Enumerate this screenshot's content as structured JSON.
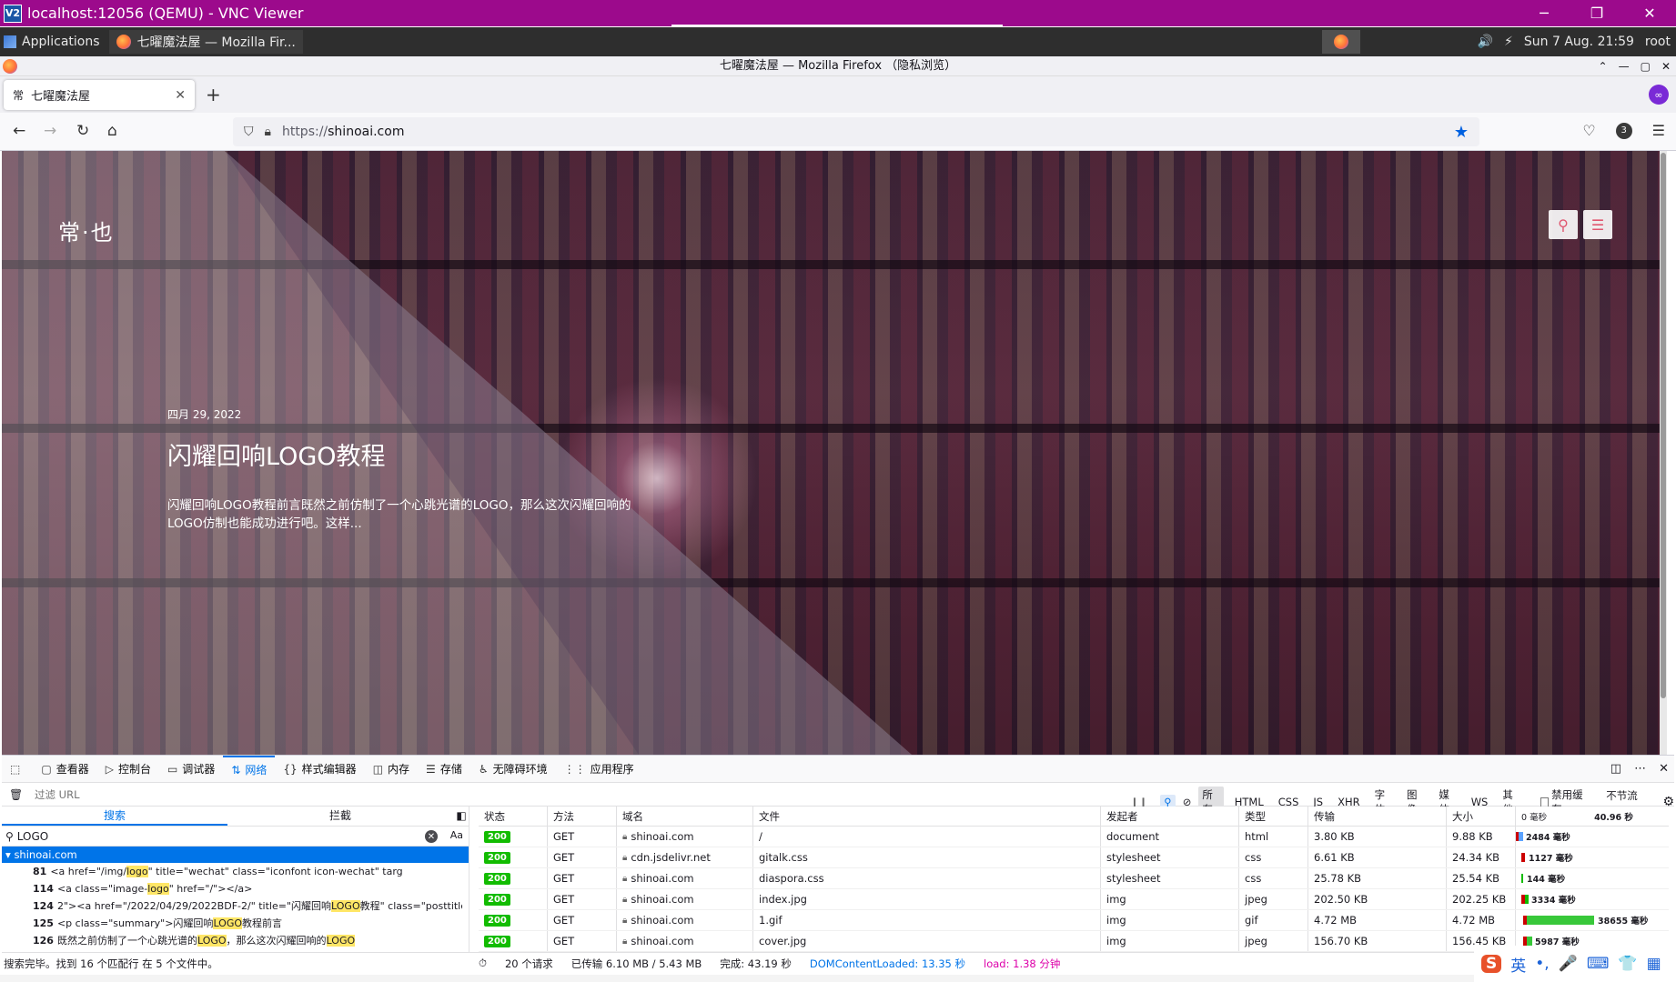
{
  "vnc": {
    "title": "localhost:12056 (QEMU) - VNC Viewer",
    "logo": "V2",
    "minimize": "─",
    "restore": "❐",
    "close": "✕"
  },
  "panel": {
    "applications": "Applications",
    "task_label": "七曜魔法屋 — Mozilla Fir...",
    "volume": "🔊",
    "net": "⚡",
    "clock": "Sun  7 Aug. 21:59",
    "user": "root"
  },
  "firefox": {
    "window_title": "七曜魔法屋 — Mozilla Firefox （隐私浏览）",
    "tab_title": "七曜魔法屋",
    "tab_favicon": "常",
    "url_proto": "https://",
    "url_host": "shinoai.com",
    "badge_count": "3"
  },
  "page": {
    "logo": "常·也",
    "post_date": "四月 29, 2022",
    "post_title": "闪耀回响LOGO教程",
    "post_summary": "闪耀回响LOGO教程前言既然之前仿制了一个心跳光谱的LOGO，那么这次闪耀回响的LOGO仿制也能成功进行吧。这样..."
  },
  "devtools": {
    "tabs": [
      {
        "icon": "▢",
        "label": "查看器"
      },
      {
        "icon": "▷",
        "label": "控制台"
      },
      {
        "icon": "▭",
        "label": "调试器"
      },
      {
        "icon": "⇅",
        "label": "网络"
      },
      {
        "icon": "{}",
        "label": "样式编辑器"
      },
      {
        "icon": "◫",
        "label": "内存"
      },
      {
        "icon": "☰",
        "label": "存储"
      },
      {
        "icon": "♿",
        "label": "无障碍环境"
      },
      {
        "icon": "⋮⋮",
        "label": "应用程序"
      }
    ],
    "filter_placeholder": "过滤 URL",
    "type_filters": [
      "所有",
      "HTML",
      "CSS",
      "JS",
      "XHR",
      "字体",
      "图像",
      "媒体",
      "WS",
      "其他"
    ],
    "disable_cache": "禁用缓存",
    "throttle": "不节流 ⌄",
    "search_tab": "搜索",
    "block_tab": "拦截",
    "search_query": "LOGO",
    "case_toggle": "Aa",
    "result_group": "shinoai.com",
    "results": [
      {
        "line": "81",
        "pre": "<a href=\"/img/",
        "hit": "logo",
        "post": "\" title=\"wechat\" class=\"iconfont icon-wechat\" targ"
      },
      {
        "line": "114",
        "pre": "<a class=\"image-",
        "hit": "logo",
        "post": "\" href=\"/\"></a>"
      },
      {
        "line": "124",
        "pre": "2\"><a href=\"/2022/04/29/2022BDF-2/\" title=\"闪耀回响",
        "hit": "LOGO",
        "post": "教程\" class=\"posttitle\">..."
      },
      {
        "line": "125",
        "pre": "<p class=\"summary\">闪耀回响",
        "hit": "LOGO",
        "post": "教程前言"
      },
      {
        "line": "126",
        "pre": "既然之前仿制了一个心跳光谱的",
        "hit": "LOGO",
        "post": "，那么这次闪耀回响的",
        "hit2": "LOGO"
      }
    ],
    "columns": [
      "状态",
      "方法",
      "域名",
      "文件",
      "发起者",
      "类型",
      "传输",
      "大小",
      "0 毫秒",
      "40.96 秒"
    ],
    "rows": [
      {
        "status": "200",
        "method": "GET",
        "domain": "shinoai.com",
        "file": "/",
        "initiator": "document",
        "type": "html",
        "transferred": "3.80 KB",
        "size": "9.88 KB",
        "timing": "2484 毫秒"
      },
      {
        "status": "200",
        "method": "GET",
        "domain": "cdn.jsdelivr.net",
        "file": "gitalk.css",
        "initiator": "stylesheet",
        "type": "css",
        "transferred": "6.61 KB",
        "size": "24.34 KB",
        "timing": "1127 毫秒"
      },
      {
        "status": "200",
        "method": "GET",
        "domain": "shinoai.com",
        "file": "diaspora.css",
        "initiator": "stylesheet",
        "type": "css",
        "transferred": "25.78 KB",
        "size": "25.54 KB",
        "timing": "144 毫秒"
      },
      {
        "status": "200",
        "method": "GET",
        "domain": "shinoai.com",
        "file": "index.jpg",
        "initiator": "img",
        "type": "jpeg",
        "transferred": "202.50 KB",
        "size": "202.25 KB",
        "timing": "3334 毫秒"
      },
      {
        "status": "200",
        "method": "GET",
        "domain": "shinoai.com",
        "file": "1.gif",
        "initiator": "img",
        "type": "gif",
        "transferred": "4.72 MB",
        "size": "4.72 MB",
        "timing": "38655 毫秒"
      },
      {
        "status": "200",
        "method": "GET",
        "domain": "shinoai.com",
        "file": "cover.jpg",
        "initiator": "img",
        "type": "jpeg",
        "transferred": "156.70 KB",
        "size": "156.45 KB",
        "timing": "5987 毫秒"
      }
    ],
    "status_search": "搜索完毕。找到 16 个匹配行 在 5 个文件中。",
    "status_requests": "20 个请求",
    "status_transferred": "已传输 6.10 MB / 5.43 MB",
    "status_finish": "完成: 43.19 秒",
    "status_dcl": "DOMContentLoaded: 13.35 秒",
    "status_load": "load: 1.38 分钟"
  },
  "ime": {
    "logo": "S",
    "lang": "英",
    "punct": "•,",
    "mic": "🎤",
    "keyboard": "⌨",
    "skin": "👕",
    "grid": "▦"
  },
  "colors": {
    "vnc_bar": "#9c0a8c",
    "accent": "#0074e8",
    "status_ok": "#12bc00"
  }
}
